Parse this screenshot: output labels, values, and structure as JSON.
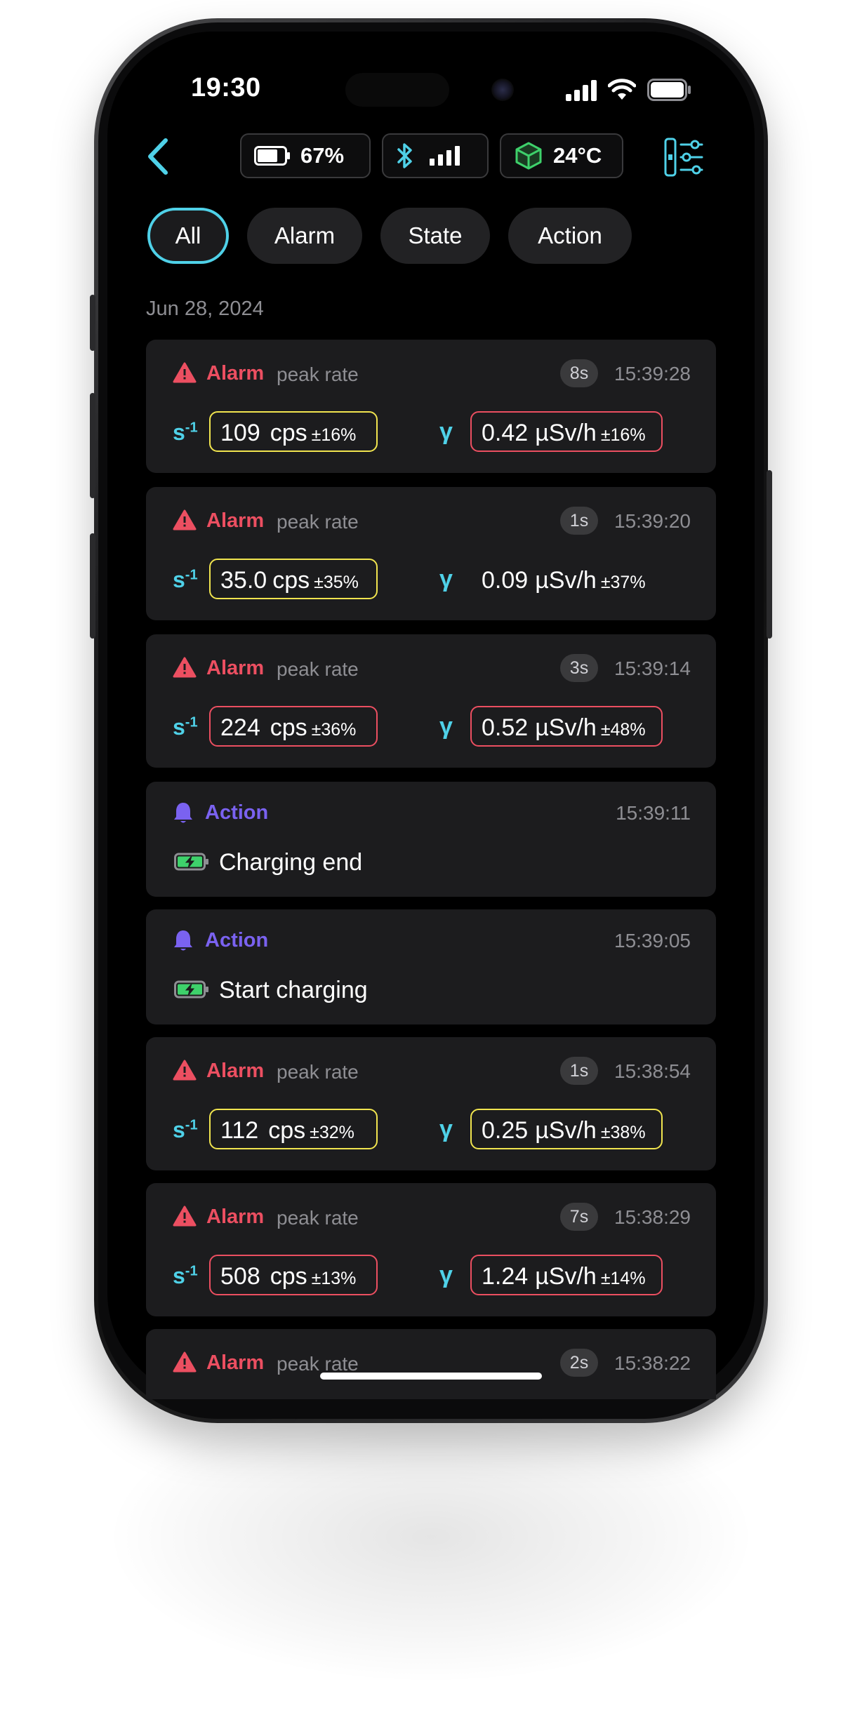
{
  "status_bar": {
    "time": "19:30"
  },
  "device_bar": {
    "battery": "67%",
    "temperature": "24°C"
  },
  "filters": [
    {
      "label": "All",
      "active": true
    },
    {
      "label": "Alarm",
      "active": false
    },
    {
      "label": "State",
      "active": false
    },
    {
      "label": "Action",
      "active": false
    }
  ],
  "date_header": "Jun 28, 2024",
  "labels": {
    "cps_symbol": "s",
    "cps_exp": "-1",
    "dose_symbol": "γ",
    "cps_unit": "cps",
    "dose_unit": "µSv/h"
  },
  "events": [
    {
      "type": "Alarm",
      "subtitle": "peak rate",
      "duration": "8s",
      "time": "15:39:28",
      "cps": "109",
      "cps_err": "±16%",
      "cps_level": "yellow",
      "dose": "0.42",
      "dose_err": "±16%",
      "dose_level": "red"
    },
    {
      "type": "Alarm",
      "subtitle": "peak rate",
      "duration": "1s",
      "time": "15:39:20",
      "cps": "35.0",
      "cps_err": "±35%",
      "cps_level": "yellow",
      "dose": "0.09",
      "dose_err": "±37%",
      "dose_level": "none"
    },
    {
      "type": "Alarm",
      "subtitle": "peak rate",
      "duration": "3s",
      "time": "15:39:14",
      "cps": "224",
      "cps_err": "±36%",
      "cps_level": "red",
      "dose": "0.52",
      "dose_err": "±48%",
      "dose_level": "red"
    },
    {
      "type": "Action",
      "time": "15:39:11",
      "text": "Charging end"
    },
    {
      "type": "Action",
      "time": "15:39:05",
      "text": "Start charging"
    },
    {
      "type": "Alarm",
      "subtitle": "peak rate",
      "duration": "1s",
      "time": "15:38:54",
      "cps": "112",
      "cps_err": "±32%",
      "cps_level": "yellow",
      "dose": "0.25",
      "dose_err": "±38%",
      "dose_level": "yellow"
    },
    {
      "type": "Alarm",
      "subtitle": "peak rate",
      "duration": "7s",
      "time": "15:38:29",
      "cps": "508",
      "cps_err": "±13%",
      "cps_level": "red",
      "dose": "1.24",
      "dose_err": "±14%",
      "dose_level": "red"
    },
    {
      "type": "Alarm",
      "subtitle": "peak rate",
      "duration": "2s",
      "time": "15:38:22"
    }
  ],
  "colors": {
    "alarm": "#ec4f61",
    "action": "#7a62f0",
    "accent": "#4fd1e8",
    "warn_yellow": "#f1e54f",
    "battery_green": "#3ed16b"
  },
  "icons": [
    "back-chevron-icon",
    "battery-icon",
    "bluetooth-icon",
    "signal-icon",
    "cube-icon",
    "settings-sliders-icon",
    "warning-triangle-icon",
    "bell-icon",
    "charging-battery-icon"
  ]
}
